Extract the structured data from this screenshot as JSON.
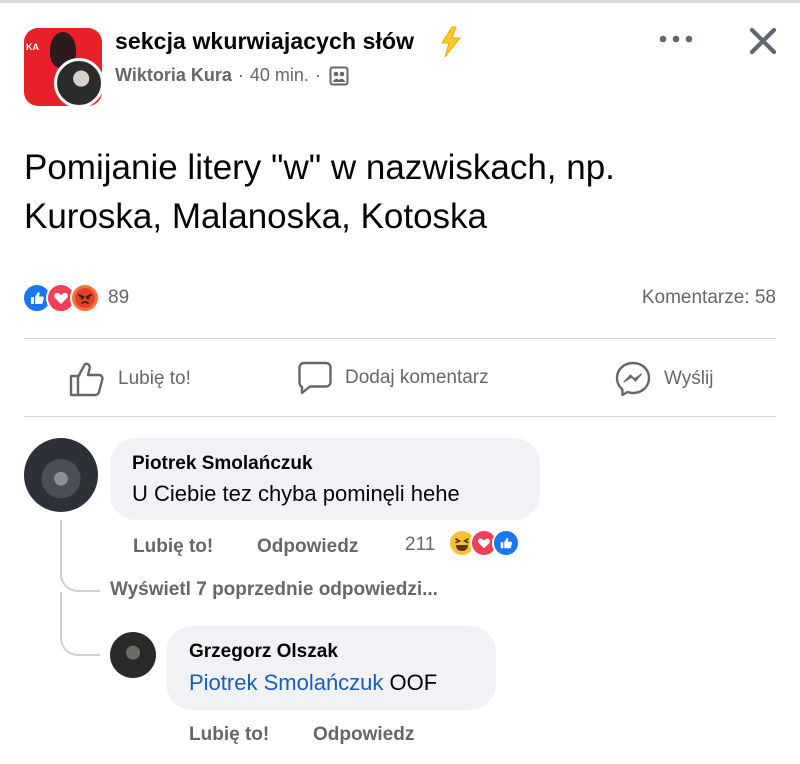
{
  "post": {
    "group_name": "sekcja wkurwiajacych słów",
    "group_avatar_text": "KA",
    "author": "Wiktoria Kura",
    "separator": "·",
    "time": "40 min.",
    "text_line1": "Pomijanie litery \"w\" w nazwiskach, np.",
    "text_line2": "Kuroska, Malanoska, Kotoska",
    "reaction_count": "89",
    "comments_label": "Komentarze: 58",
    "reactions": [
      "like-icon",
      "love-icon",
      "angry-icon"
    ]
  },
  "actions": {
    "like": "Lubię to!",
    "comment": "Dodaj komentarz",
    "send": "Wyślij"
  },
  "comments": [
    {
      "author": "Piotrek Smolańczuk",
      "text": "U Ciebie tez chyba pominęli hehe",
      "like_label": "Lubię to!",
      "reply_label": "Odpowiedz",
      "reaction_count": "211",
      "reactions": [
        "haha-icon",
        "love-icon",
        "like-icon"
      ]
    }
  ],
  "view_previous_replies": "Wyświetl 7 poprzednie odpowiedzi...",
  "replies": [
    {
      "author": "Grzegorz Olszak",
      "mention": "Piotrek Smolańczuk",
      "text": " OOF",
      "like_label": "Lubię to!",
      "reply_label": "Odpowiedz"
    }
  ],
  "colors": {
    "like": "#1877f2",
    "love": "#f33e58",
    "angry": "#f5743b",
    "mention": "#1a5fb4",
    "secondary_text": "#65676b",
    "bubble": "#f0f2f5",
    "group_avatar": "#e8202a"
  }
}
